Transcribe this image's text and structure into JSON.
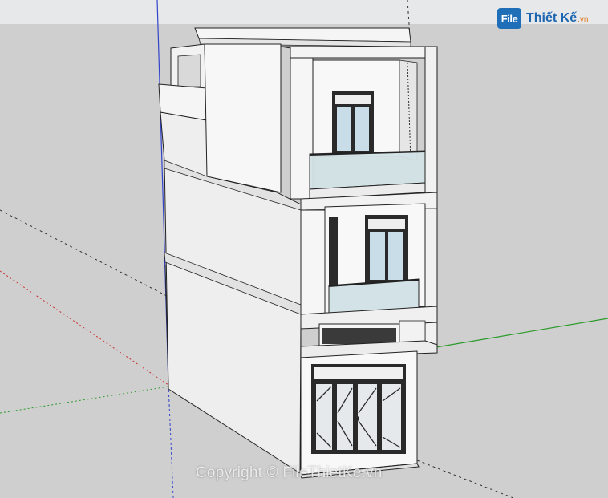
{
  "logo": {
    "mark": "File",
    "name": "Thiết Kế",
    "suffix": ".vn"
  },
  "watermark": {
    "text": "Copyright © FileThietKe.vn"
  },
  "colors": {
    "sky": "#e6e8ea",
    "ground": "#cfcfcf",
    "wall": "#f4f4f4",
    "wall_side": "#ececec",
    "frame": "#2a2a2a",
    "glass": "#c8dde8",
    "railing_glass": "#d3e2e6",
    "blue_axis": "#3344cc",
    "green_axis": "#2a9a2a",
    "red_axis": "#cc3333",
    "logo_blue": "#1e6fb8",
    "logo_orange": "#e07a1c"
  }
}
